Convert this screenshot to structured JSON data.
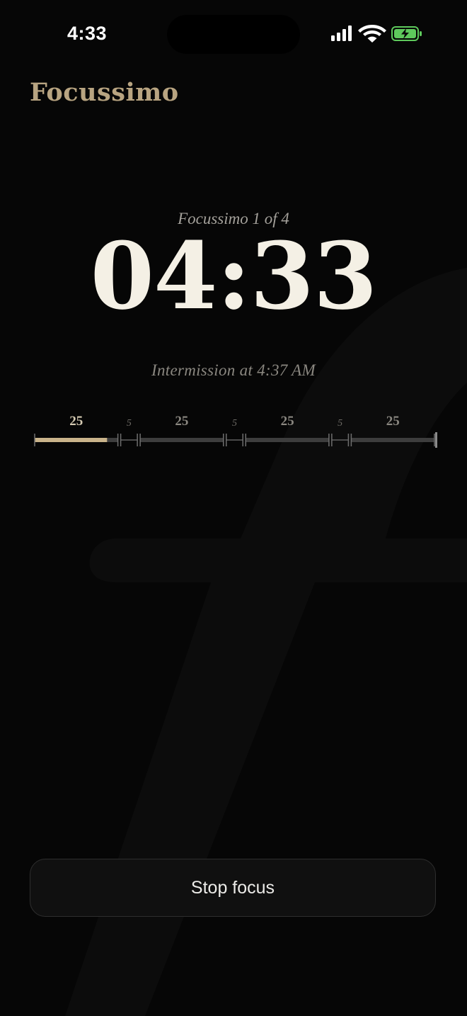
{
  "status_bar": {
    "time": "4:33",
    "icons": [
      "cellular-signal-icon",
      "wifi-icon",
      "battery-charging-icon"
    ],
    "battery_color": "#5ec95c"
  },
  "app": {
    "title": "Focussimo",
    "accent_color": "#b8a481"
  },
  "session": {
    "label": "Focussimo 1 of 4",
    "timer": "04:33",
    "intermission": "Intermission at 4:37 AM"
  },
  "timeline": {
    "segments": [
      {
        "label": "25",
        "type": "focus",
        "minutes": 25,
        "progress": 0.87
      },
      {
        "label": "5",
        "type": "break",
        "minutes": 5,
        "progress": 0
      },
      {
        "label": "25",
        "type": "focus",
        "minutes": 25,
        "progress": 0
      },
      {
        "label": "5",
        "type": "break",
        "minutes": 5,
        "progress": 0
      },
      {
        "label": "25",
        "type": "focus",
        "minutes": 25,
        "progress": 0
      },
      {
        "label": "5",
        "type": "break",
        "minutes": 5,
        "progress": 0
      },
      {
        "label": "25",
        "type": "focus",
        "minutes": 25,
        "progress": 0
      }
    ],
    "active_color": "#c9b38a",
    "inactive_color": "#3d3d3d"
  },
  "actions": {
    "stop_label": "Stop focus"
  }
}
